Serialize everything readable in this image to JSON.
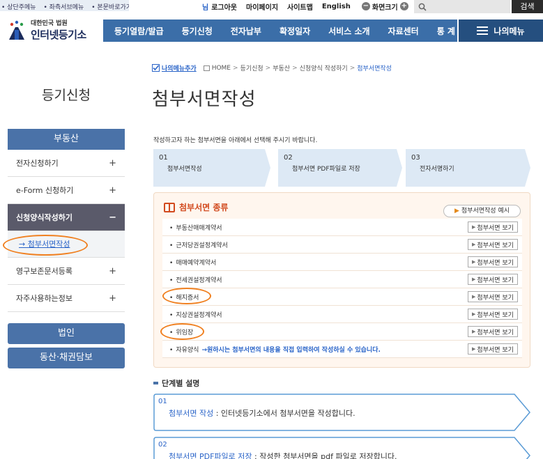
{
  "skip_links": [
    "상단주메뉴",
    "좌측서브메뉴",
    "본문바로가기"
  ],
  "util": {
    "logout": "로그아웃",
    "mypage": "마이페이지",
    "sitemap": "사이트맵",
    "english": "English",
    "zoom_minus": "−",
    "zoom_label": "화면크기",
    "zoom_plus": "+",
    "search_placeholder": "",
    "search_button": "검색"
  },
  "logo": {
    "sub": "대한민국 법원",
    "main": "인터넷등기소"
  },
  "gnb": [
    "등기열람/발급",
    "등기신청",
    "전자납부",
    "확정일자",
    "서비스 소개",
    "자료센터",
    "통 계"
  ],
  "mymenu": "나의메뉴",
  "sidebar": {
    "title": "등기신청",
    "section": "부동산",
    "items": [
      {
        "label": "전자신청하기",
        "toggle": "+"
      },
      {
        "label": "e-Form 신청하기",
        "toggle": "+"
      },
      {
        "label": "신청양식작성하기",
        "toggle": "−"
      }
    ],
    "sub_item": "→ 첨부서면작성",
    "items2": [
      {
        "label": "영구보존문서등록",
        "toggle": "+"
      },
      {
        "label": "자주사용하는정보",
        "toggle": "+"
      }
    ],
    "btn_corp": "법인",
    "btn_movable": "동산·채권담보"
  },
  "breadcrumb": {
    "add": "나의메뉴추가",
    "path": [
      "HOME",
      "등기신청",
      "부동산",
      "신청양식 작성하기"
    ],
    "current": "첨부서면작성"
  },
  "page_title": "첨부서면작성",
  "intro": "작성하고자 하는 첨부서면을 아래에서 선택해 주시기 바랍니다.",
  "steps": [
    {
      "num": "01",
      "label": "첨부서면작성"
    },
    {
      "num": "02",
      "label": "첨부서면 PDF파일로 저장"
    },
    {
      "num": "03",
      "label": "전자서명하기"
    }
  ],
  "panel": {
    "title": "첨부서면 종류",
    "example_btn": "첨부서면작성 예시",
    "view_label": "첨부서면 보기",
    "docs": [
      {
        "name": "부동산매매계약서",
        "note": ""
      },
      {
        "name": "근저당권설정계약서",
        "note": ""
      },
      {
        "name": "매매예약계약서",
        "note": ""
      },
      {
        "name": "전세권설정계약서",
        "note": ""
      },
      {
        "name": "해지증서",
        "note": ""
      },
      {
        "name": "지상권설정계약서",
        "note": ""
      },
      {
        "name": "위임장",
        "note": ""
      },
      {
        "name": "자유양식",
        "note": "→원하시는 첨부서면의 내용을 직접 입력하여 작성하실 수 있습니다."
      }
    ]
  },
  "step_desc": {
    "title": "단계별 설명",
    "items": [
      {
        "num": "01",
        "highlight": "첨부서면 작성",
        "text": " : 인터넷등기소에서 첨부서면을 작성합니다."
      },
      {
        "num": "02",
        "highlight": "첨부서면 PDF파일로 저장",
        "text": " : 작성한 첨부서면을 pdf 파일로 저장합니다."
      }
    ]
  },
  "colors": {
    "nav": "#3b6ea8",
    "nav_dark": "#254f7f",
    "link": "#2a64c8",
    "accent": "#d24a1e",
    "marker": "#f08020"
  }
}
